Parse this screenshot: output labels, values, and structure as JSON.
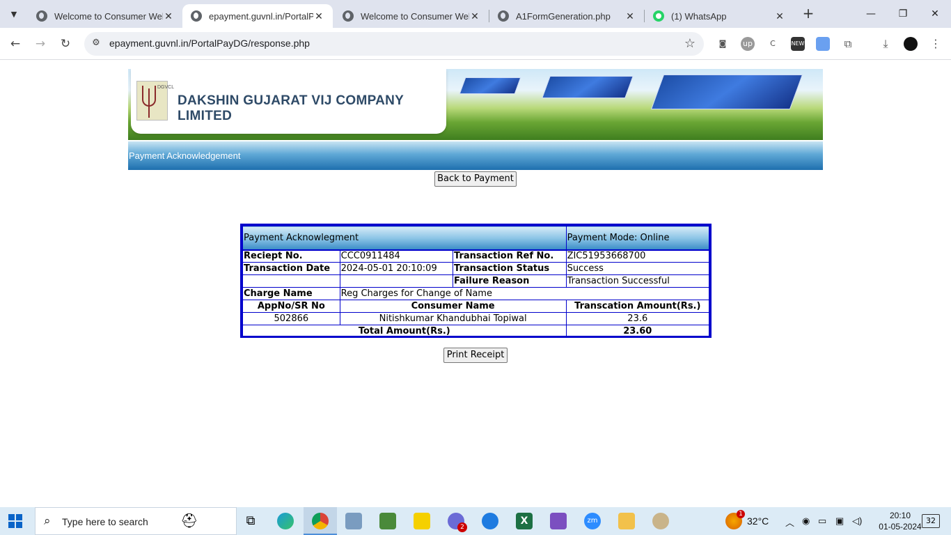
{
  "browser": {
    "tabs": [
      {
        "title": "Welcome to Consumer Web"
      },
      {
        "title": "epayment.guvnl.in/PortalPay"
      },
      {
        "title": "Welcome to Consumer Web"
      },
      {
        "title": "A1FormGeneration.php"
      },
      {
        "title": "(1) WhatsApp"
      }
    ],
    "url": "epayment.guvnl.in/PortalPayDG/response.php"
  },
  "header": {
    "logo_letters": "DGVCL",
    "company_name": "DAKSHIN GUJARAT VIJ COMPANY LIMITED",
    "page_title": "Payment Acknowledgement"
  },
  "buttons": {
    "back": "Back to Payment",
    "print": "Print Receipt"
  },
  "receipt": {
    "heading": "Payment Acknowlegment",
    "mode": "Payment Mode: Online",
    "receipt_no_label": "Reciept No.",
    "receipt_no": "CCC0911484",
    "txn_ref_label": "Transaction Ref No.",
    "txn_ref": "ZIC51953668700",
    "txn_date_label": "Transaction Date",
    "txn_date": "2024-05-01 20:10:09",
    "txn_status_label": "Transaction Status",
    "txn_status": "Success",
    "failure_label": "Failure Reason",
    "failure_reason": "Transaction Successful",
    "charge_label": "Charge Name",
    "charge_name": "Reg Charges for Change of Name",
    "col_app": "AppNo/SR No",
    "col_consumer": "Consumer Name",
    "col_amount": "Transcation Amount(Rs.)",
    "app_no": "502866",
    "consumer_name": "Nitishkumar Khandubhai Topiwal",
    "amount": "23.6",
    "total_label": "Total Amount(Rs.)",
    "total": "23.60"
  },
  "taskbar": {
    "search_placeholder": "Type here to search",
    "weather": "32°C",
    "time": "20:10",
    "date": "01-05-2024",
    "notifications": "32",
    "weather_badge": "1",
    "teams_badge": "2"
  },
  "colors": {
    "table_border": "#0000cc",
    "bar_blue": "#1e6fae",
    "company_text": "#2e4a67"
  }
}
